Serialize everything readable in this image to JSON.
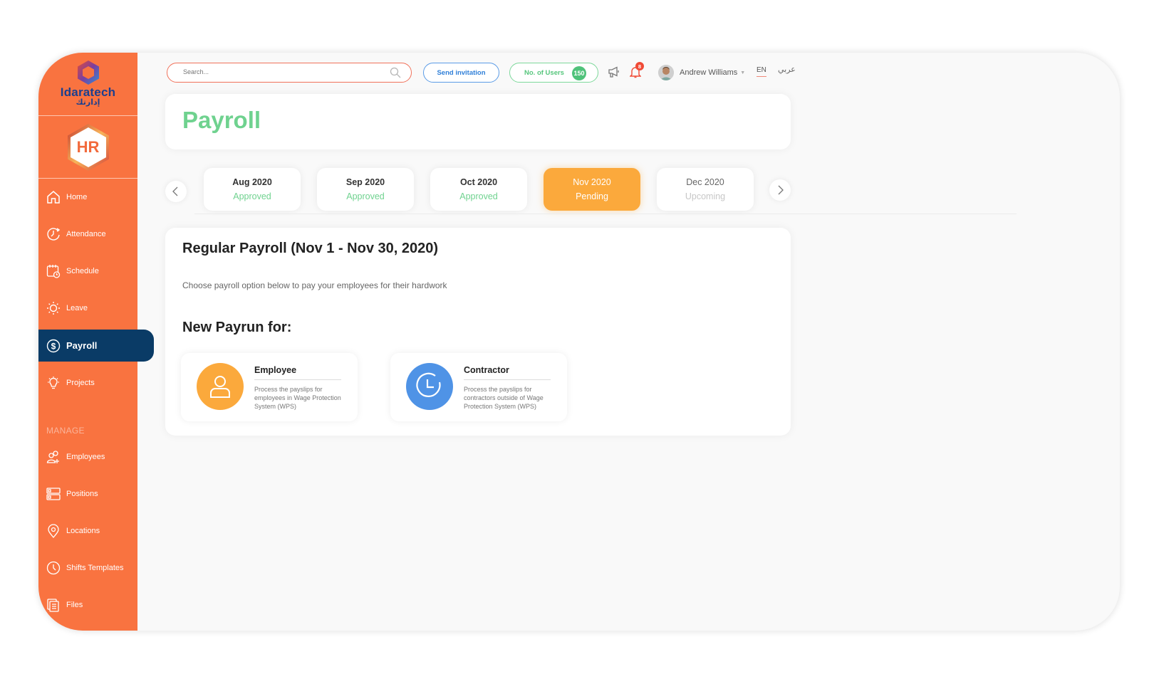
{
  "brand": {
    "name": "Idaratech",
    "name_arabic": "إدارتك",
    "module": "HR",
    "primary_color": "#f97340",
    "active_nav_color": "#0a3b66"
  },
  "sidebar": {
    "items": [
      {
        "label": "Home",
        "icon": "home-icon"
      },
      {
        "label": "Attendance",
        "icon": "attendance-icon"
      },
      {
        "label": "Schedule",
        "icon": "calendar-icon"
      },
      {
        "label": "Leave",
        "icon": "sun-icon"
      },
      {
        "label": "Payroll",
        "icon": "dollar-icon",
        "active": true
      },
      {
        "label": "Projects",
        "icon": "lightbulb-icon"
      }
    ],
    "section_label": "MANAGE",
    "manage_items": [
      {
        "label": "Employees",
        "icon": "users-add-icon"
      },
      {
        "label": "Positions",
        "icon": "server-icon"
      },
      {
        "label": "Locations",
        "icon": "location-pin-icon"
      },
      {
        "label": "Shifts Templates",
        "icon": "clock-icon"
      },
      {
        "label": "Files",
        "icon": "files-icon"
      }
    ]
  },
  "topbar": {
    "search_placeholder": "Search...",
    "invite_label": "Send invitation",
    "users_label": "No. of Users",
    "users_count": "150",
    "notifications_count": "8",
    "user_name": "Andrew Williams",
    "lang_en": "EN",
    "lang_ar": "عربي"
  },
  "page": {
    "title": "Payroll"
  },
  "months": [
    {
      "label": "Aug 2020",
      "status": "Approved"
    },
    {
      "label": "Sep 2020",
      "status": "Approved"
    },
    {
      "label": "Oct 2020",
      "status": "Approved"
    },
    {
      "label": "Nov 2020",
      "status": "Pending"
    },
    {
      "label": "Dec 2020",
      "status": "Upcoming"
    }
  ],
  "payroll": {
    "heading": "Regular Payroll (Nov 1 - Nov 30, 2020)",
    "subtitle": "Choose payroll option below to pay your employees for their hardwork",
    "payrun_heading": "New Payrun for:",
    "options": [
      {
        "title": "Employee",
        "description": "Process the payslips for employees in Wage Protection System (WPS)",
        "color": "#fba93c"
      },
      {
        "title": "Contractor",
        "description": "Process the payslips for contractors outside of Wage Protection System (WPS)",
        "color": "#4f93e6"
      }
    ]
  }
}
